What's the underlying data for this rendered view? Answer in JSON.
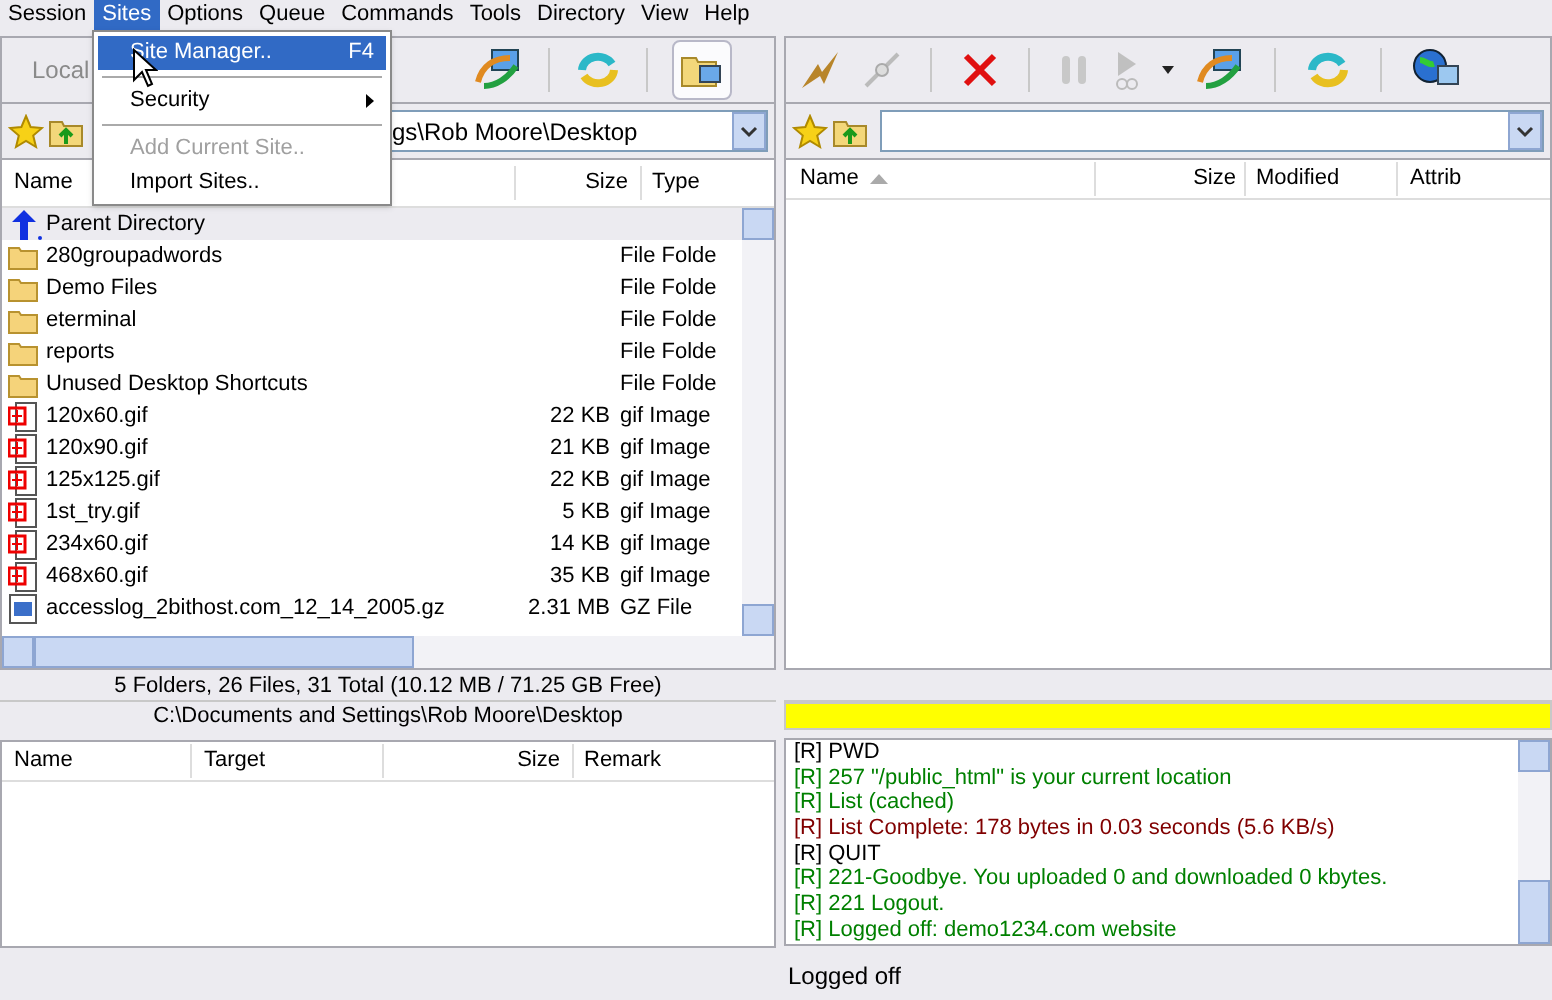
{
  "menu_bar": [
    {
      "label": "Session",
      "selected": false
    },
    {
      "label": "Sites",
      "selected": true
    },
    {
      "label": "Options",
      "selected": false
    },
    {
      "label": "Queue",
      "selected": false
    },
    {
      "label": "Commands",
      "selected": false
    },
    {
      "label": "Tools",
      "selected": false
    },
    {
      "label": "Directory",
      "selected": false
    },
    {
      "label": "View",
      "selected": false
    },
    {
      "label": "Help",
      "selected": false
    }
  ],
  "sites_menu": [
    {
      "kind": "item",
      "label": "Site Manager..",
      "shortcut": "F4",
      "selected": true,
      "disabled": false
    },
    {
      "kind": "separator"
    },
    {
      "kind": "submenu",
      "label": "Security",
      "selected": false,
      "disabled": false
    },
    {
      "kind": "separator"
    },
    {
      "kind": "item",
      "label": "Add Current Site..",
      "selected": false,
      "disabled": true
    },
    {
      "kind": "item",
      "label": "Import Sites..",
      "selected": false,
      "disabled": false
    }
  ],
  "local": {
    "toolbar_label": "Local",
    "path": "gs\\Rob Moore\\Desktop",
    "columns": [
      "Name",
      "Size",
      "Type"
    ],
    "rows": [
      {
        "kind": "parent",
        "name": "Parent Directory"
      },
      {
        "kind": "folder",
        "name": "280groupadwords",
        "type": "File Folde"
      },
      {
        "kind": "folder",
        "name": "Demo Files",
        "type": "File Folde"
      },
      {
        "kind": "folder",
        "name": "eterminal",
        "type": "File Folde"
      },
      {
        "kind": "folder",
        "name": "reports",
        "type": "File Folde"
      },
      {
        "kind": "folder",
        "name": "Unused Desktop Shortcuts",
        "type": "File Folde"
      },
      {
        "kind": "image",
        "name": "120x60.gif",
        "size": "22 KB",
        "type": "gif Image"
      },
      {
        "kind": "image",
        "name": "120x90.gif",
        "size": "21 KB",
        "type": "gif Image"
      },
      {
        "kind": "image",
        "name": "125x125.gif",
        "size": "22 KB",
        "type": "gif Image"
      },
      {
        "kind": "image",
        "name": "1st_try.gif",
        "size": "5 KB",
        "type": "gif Image"
      },
      {
        "kind": "image",
        "name": "234x60.gif",
        "size": "14 KB",
        "type": "gif Image"
      },
      {
        "kind": "image",
        "name": "468x60.gif",
        "size": "35 KB",
        "type": "gif Image"
      },
      {
        "kind": "archive",
        "name": "accesslog_2bithost.com_12_14_2005.gz",
        "size": "2.31 MB",
        "type": "GZ File"
      }
    ],
    "summary": "5 Folders, 26 Files, 31 Total (10.12 MB / 71.25 GB Free)",
    "full_path": "C:\\Documents and Settings\\Rob Moore\\Desktop"
  },
  "remote": {
    "columns": [
      "Name",
      "Size",
      "Modified",
      "Attrib"
    ]
  },
  "transfer_progress": {
    "level": 1
  },
  "queue": {
    "columns": [
      "Name",
      "Target",
      "Size",
      "Remark"
    ]
  },
  "log": [
    {
      "text": "[R] PWD",
      "color": "#000000"
    },
    {
      "text": "[R] 257 \"/public_html\" is your current location",
      "color": "#008000"
    },
    {
      "text": "[R] List (cached)",
      "color": "#008000"
    },
    {
      "text": "[R] List Complete: 178 bytes in 0.03 seconds (5.6 KB/s)",
      "color": "#800000"
    },
    {
      "text": "[R] QUIT",
      "color": "#000000"
    },
    {
      "text": "[R] 221-Goodbye. You uploaded 0 and downloaded 0 kbytes.",
      "color": "#008000"
    },
    {
      "text": "[R] 221 Logout.",
      "color": "#008000"
    },
    {
      "text": "[R] Logged off: demo1234.com website",
      "color": "#008000"
    }
  ],
  "status_bar": {
    "text": "Logged off"
  }
}
